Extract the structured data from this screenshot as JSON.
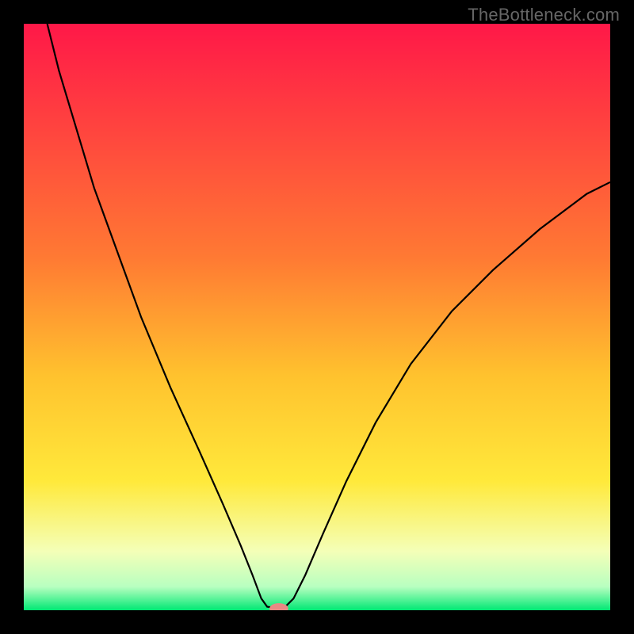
{
  "watermark": "TheBottleneck.com",
  "chart_data": {
    "type": "line",
    "title": "",
    "xlabel": "",
    "ylabel": "",
    "xlim": [
      0,
      100
    ],
    "ylim": [
      0,
      100
    ],
    "gradient_stops": [
      {
        "offset": 0,
        "color": "#ff1848"
      },
      {
        "offset": 0.4,
        "color": "#ff7a33"
      },
      {
        "offset": 0.6,
        "color": "#ffc22e"
      },
      {
        "offset": 0.78,
        "color": "#ffe93b"
      },
      {
        "offset": 0.9,
        "color": "#f4ffb8"
      },
      {
        "offset": 0.96,
        "color": "#b8ffc0"
      },
      {
        "offset": 1.0,
        "color": "#00e874"
      }
    ],
    "series": [
      {
        "name": "bottleneck-curve",
        "color": "#000000",
        "points": [
          {
            "x": 4,
            "y": 100
          },
          {
            "x": 6,
            "y": 92
          },
          {
            "x": 9,
            "y": 82
          },
          {
            "x": 12,
            "y": 72
          },
          {
            "x": 16,
            "y": 61
          },
          {
            "x": 20,
            "y": 50
          },
          {
            "x": 25,
            "y": 38
          },
          {
            "x": 30,
            "y": 27
          },
          {
            "x": 34,
            "y": 18
          },
          {
            "x": 37,
            "y": 11
          },
          {
            "x": 39,
            "y": 6
          },
          {
            "x": 40.5,
            "y": 2
          },
          {
            "x": 41.5,
            "y": 0.6
          },
          {
            "x": 43,
            "y": 0.4
          },
          {
            "x": 44.5,
            "y": 0.5
          },
          {
            "x": 46,
            "y": 2
          },
          {
            "x": 48,
            "y": 6
          },
          {
            "x": 51,
            "y": 13
          },
          {
            "x": 55,
            "y": 22
          },
          {
            "x": 60,
            "y": 32
          },
          {
            "x": 66,
            "y": 42
          },
          {
            "x": 73,
            "y": 51
          },
          {
            "x": 80,
            "y": 58
          },
          {
            "x": 88,
            "y": 65
          },
          {
            "x": 96,
            "y": 71
          },
          {
            "x": 100,
            "y": 73
          }
        ]
      }
    ],
    "marker": {
      "x": 43.5,
      "y": 0.3,
      "color": "#e98a84",
      "rx": 1.6,
      "ry": 0.9
    }
  }
}
